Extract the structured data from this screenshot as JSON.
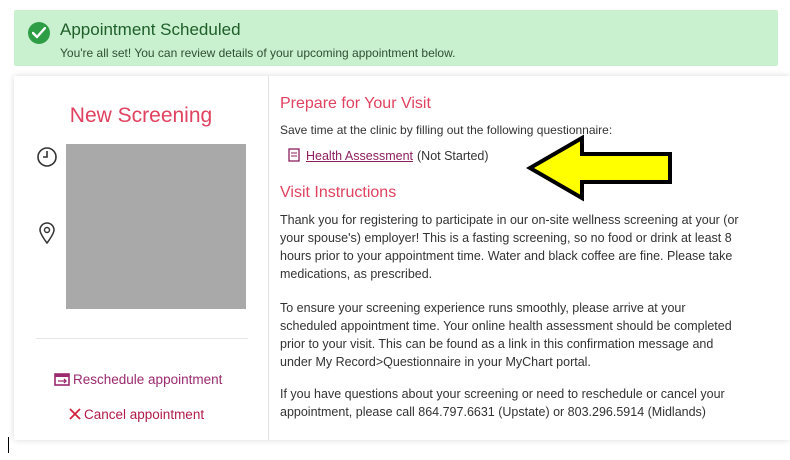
{
  "banner": {
    "title": "Appointment Scheduled",
    "subtitle": "You're all set! You can review details of your upcoming appointment below.",
    "color": "#c9f0cf",
    "icon": "check-circle-icon"
  },
  "appointment": {
    "title": "New Screening",
    "icons": [
      "clock-icon",
      "location-pin-icon"
    ],
    "reschedule_label": "Reschedule appointment",
    "cancel_label": "Cancel appointment"
  },
  "prepare": {
    "heading": "Prepare for Your Visit",
    "text": "Save time at the clinic by filling out the following questionnaire:",
    "questionnaire_link": "Health Assessment",
    "questionnaire_status": "(Not Started)"
  },
  "instructions": {
    "heading": "Visit Instructions",
    "lines": [
      "Thank you for registering to participate in our on-site wellness screening at your (or",
      "your spouse's) employer!  This is a fasting screening, so no food or drink at least 8",
      "hours prior to your appointment time.  Water and black coffee are fine.  Please take",
      "medications, as prescribed.",
      "To ensure your screening experience runs smoothly, please arrive at your",
      "scheduled appointment time.  Your online health assessment should be completed",
      "prior to your visit.  This can be found as a link in this confirmation message and",
      "under My Record>Questionnaire in your MyChart portal.",
      "If you have questions about your screening or need to reschedule or cancel your",
      "appointment, please call 864.797.6631 (Upstate) or 803.296.5914 (Midlands)"
    ]
  },
  "colors": {
    "accent": "#e0425f",
    "link": "#8d1f5e",
    "arrow_fill": "#ffff00"
  }
}
